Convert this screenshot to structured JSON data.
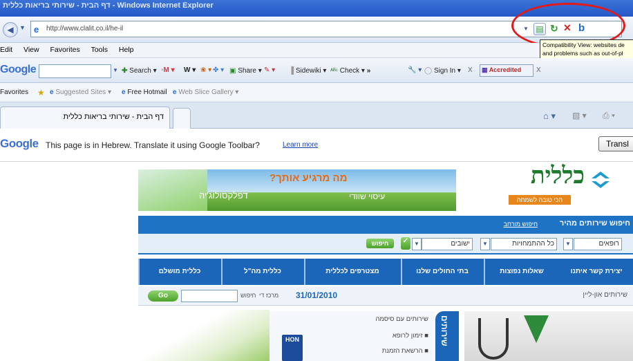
{
  "window": {
    "title": "דף הבית - שירותי בריאות כללית - Windows Internet Explorer"
  },
  "address_bar": {
    "url": "http://www.clalit.co.il/he-il"
  },
  "menu": {
    "items": [
      "Edit",
      "View",
      "Favorites",
      "Tools",
      "Help"
    ]
  },
  "google_toolbar": {
    "logo": "Google",
    "search_label": "Search",
    "share_label": "Share",
    "sidewiki_label": "Sidewiki",
    "check_label": "Check",
    "more_label": "»",
    "signin_label": "Sign In",
    "accredited_label": "Accredited"
  },
  "favorites_bar": {
    "label": "Favorites",
    "items": [
      "Suggested Sites ▾",
      "Free Hotmail",
      "Web Slice Gallery ▾"
    ]
  },
  "tab": {
    "title": "דף הבית - שירותי בריאות כללית"
  },
  "tooltip": {
    "text_line1": "Compatibility View: websites de",
    "text_line2": "and problems such as out-of-pl"
  },
  "translate_bar": {
    "logo": "Google",
    "message": "This page is in Hebrew.  Translate it using Google Toolbar?",
    "learn_more": "Learn more",
    "translate_button": "Transl"
  },
  "site": {
    "logo_text": "כללית",
    "slogan": "הכי טובה לשמחה",
    "banner_heading": "מה מרגיע אותך?",
    "banner_sub1": "דפלקסולוג'יה",
    "banner_sub2": "עיסוי שוודי",
    "quick_search_title": "חיפוש שירותים מהיר",
    "advanced_search_link": "חיפוש מורחב",
    "field_type": "רופאים",
    "field_specialty": "כל ההתמחויות",
    "field_city": "ישובים",
    "search_button": "חיפוש",
    "nav": [
      "יצירת קשר איתנו",
      "שאלות נפוצות",
      "בתי החולים שלנו",
      "מצטרפים לכללית",
      "כללית מה\"ל",
      "כללית מושלם"
    ],
    "online_services": "שירותים און-ליין",
    "date_label": "מרכז די",
    "date": "31/01/2010",
    "search_label": "חיפוש",
    "go_button": "Go",
    "services_list_title": "שירותים עם סיסמה",
    "services_list": [
      "זימון לרופא",
      "הרשאת הזמנת"
    ],
    "services_vertical": "שירותים",
    "hon_badge": "HON"
  }
}
